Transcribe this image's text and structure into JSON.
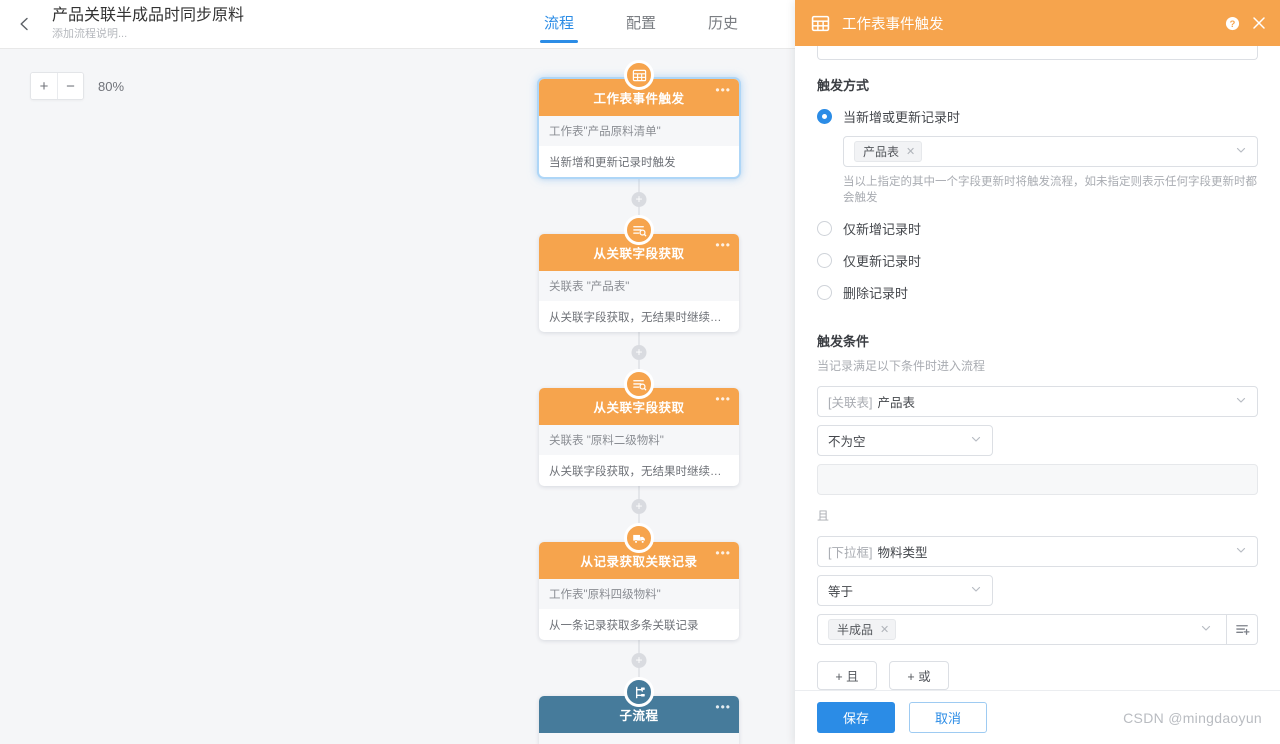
{
  "header": {
    "back_icon": "arrow-left-icon",
    "title": "产品关联半成品时同步原料",
    "subtitle": "添加流程说明...",
    "tabs": [
      {
        "label": "流程",
        "active": true
      },
      {
        "label": "配置",
        "active": false
      },
      {
        "label": "历史",
        "active": false
      }
    ]
  },
  "canvas": {
    "zoom": {
      "zoom_in_label": "+",
      "zoom_out_label": "−",
      "percent": "80%"
    },
    "add_node_label": "+",
    "nodes": [
      {
        "title": "工作表事件触发",
        "icon": "grid-table-icon",
        "color": "orange",
        "selected": true,
        "line1": "工作表\"产品原料清单\"",
        "line2": "当新增和更新记录时触发",
        "menu_icon": "more-dots-icon"
      },
      {
        "title": "从关联字段获取",
        "icon": "list-search-icon",
        "color": "orange",
        "selected": false,
        "line1": "关联表 \"产品表\"",
        "line2": "从关联字段获取，无结果时继续执行",
        "menu_icon": "more-dots-icon"
      },
      {
        "title": "从关联字段获取",
        "icon": "list-search-icon",
        "color": "orange",
        "selected": false,
        "line1": "关联表 \"原料二级物料\"",
        "line2": "从关联字段获取，无结果时继续执行",
        "menu_icon": "more-dots-icon"
      },
      {
        "title": "从记录获取关联记录",
        "icon": "truck-icon",
        "color": "orange",
        "selected": false,
        "line1": "工作表\"原料四级物料\"",
        "line2": "从一条记录获取多条关联记录",
        "menu_icon": "more-dots-icon"
      },
      {
        "title": "子流程",
        "icon": "subflow-icon",
        "color": "steel",
        "selected": false,
        "line1": "",
        "line2": "",
        "menu_icon": "more-dots-icon"
      }
    ]
  },
  "panel": {
    "icon": "grid-table-icon",
    "title": "工作表事件触发",
    "help_icon": "question-circle-icon",
    "close_icon": "close-icon",
    "trigger_mode": {
      "label": "触发方式",
      "options": [
        {
          "label": "当新增或更新记录时",
          "checked": true
        },
        {
          "label": "仅新增记录时",
          "checked": false
        },
        {
          "label": "仅更新记录时",
          "checked": false
        },
        {
          "label": "删除记录时",
          "checked": false
        }
      ],
      "field_select": {
        "chips": [
          {
            "text": "产品表",
            "remove_icon": "close-small-icon"
          }
        ],
        "caret_icon": "chevron-down-icon"
      },
      "hint": "当以上指定的其中一个字段更新时将触发流程，如未指定则表示任何字段更新时都会触发"
    },
    "trigger_condition": {
      "label": "触发条件",
      "sub": "当记录满足以下条件时进入流程",
      "groups": [
        {
          "field": {
            "prefix": "[关联表]",
            "value": "产品表",
            "caret_icon": "chevron-down-icon"
          },
          "operator": {
            "value": "不为空",
            "caret_icon": "chevron-down-icon"
          },
          "value_kind": "blank",
          "value": "",
          "join": "且"
        },
        {
          "field": {
            "prefix": "[下拉框]",
            "value": "物料类型",
            "caret_icon": "chevron-down-icon"
          },
          "operator": {
            "value": "等于",
            "caret_icon": "chevron-down-icon"
          },
          "value_kind": "chips",
          "chips": [
            {
              "text": "半成品",
              "remove_icon": "close-small-icon"
            }
          ],
          "caret_icon": "chevron-down-icon",
          "side_button_icon": "list-add-icon"
        }
      ],
      "add_and_label": "+ 且",
      "add_or_label": "+ 或"
    },
    "footer": {
      "save_label": "保存",
      "cancel_label": "取消",
      "watermark": "CSDN @mingdaoyun"
    }
  }
}
